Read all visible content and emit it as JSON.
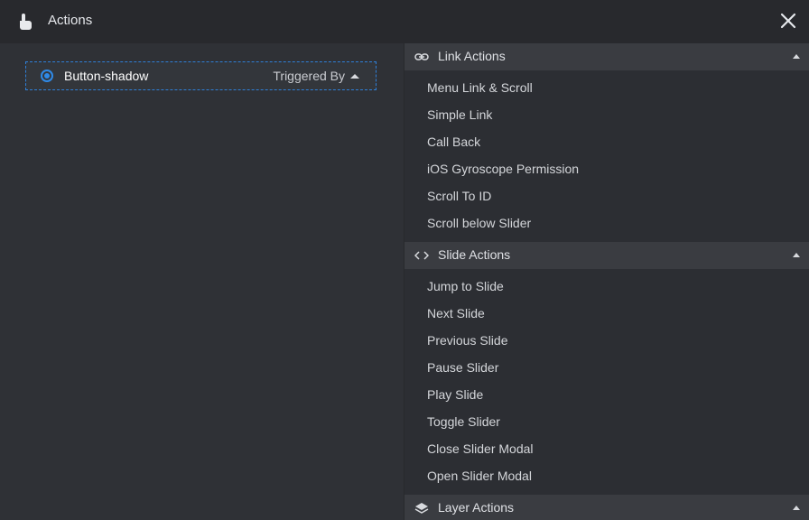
{
  "header": {
    "title": "Actions",
    "icon": "hand-pointer-icon",
    "close_icon": "close-icon"
  },
  "trigger": {
    "name": "Button-shadow",
    "triggered_by_label": "Triggered By",
    "accent_color": "#2f8ae8"
  },
  "sections": [
    {
      "label": "Link Actions",
      "icon": "link-icon",
      "items": [
        "Menu Link & Scroll",
        "Simple Link",
        "Call Back",
        "iOS Gyroscope Permission",
        "Scroll To ID",
        "Scroll below Slider"
      ]
    },
    {
      "label": "Slide Actions",
      "icon": "code-arrows-icon",
      "items": [
        "Jump to Slide",
        "Next Slide",
        "Previous Slide",
        "Pause Slider",
        "Play Slide",
        "Toggle Slider",
        "Close Slider Modal",
        "Open Slider Modal"
      ]
    },
    {
      "label": "Layer Actions",
      "icon": "layers-icon",
      "items": []
    }
  ]
}
